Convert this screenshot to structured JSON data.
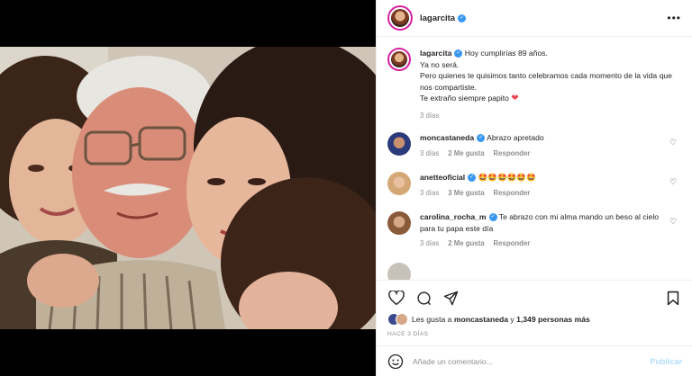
{
  "post": {
    "username": "lagarcita",
    "verified": true,
    "caption_lines": [
      "Hoy cumplirías 89 años.",
      "Ya no será.",
      "Pero quienes te quisimos tanto celebramos cada momento de la vida que nos compartiste.",
      "Te extraño siempre papito"
    ],
    "caption_time": "3 días"
  },
  "comments": [
    {
      "user": "moncastaneda",
      "text": "Abrazo apretado",
      "time": "3 días",
      "likes": "2 Me gusta",
      "reply": "Responder",
      "avatar_color": "#3b4a8f"
    },
    {
      "user": "anetteoficial",
      "text": "🤩🤩🤩🤩🤩🤩",
      "time": "3 días",
      "likes": "3 Me gusta",
      "reply": "Responder",
      "avatar_color": "#d9a785"
    },
    {
      "user": "carolina_rocha_m",
      "text": "Te abrazo con mi alma mando un beso al cielo para tu papa este día",
      "time": "3 días",
      "likes": "2 Me gusta",
      "reply": "Responder",
      "avatar_color": "#b48a6a"
    }
  ],
  "actions": {
    "liked_by_prefix": "Les gusta a",
    "liked_by_user": "moncastaneda",
    "liked_by_and": "y",
    "liked_by_count": "1,349 personas más",
    "time_ago": "HACE 3 DÍAS"
  },
  "composer": {
    "placeholder": "Añade un comentario...",
    "publish_label": "Publicar"
  },
  "colors": {
    "verified": "#3897f0",
    "publish": "#b2dffc",
    "heart": "#ed4956"
  }
}
